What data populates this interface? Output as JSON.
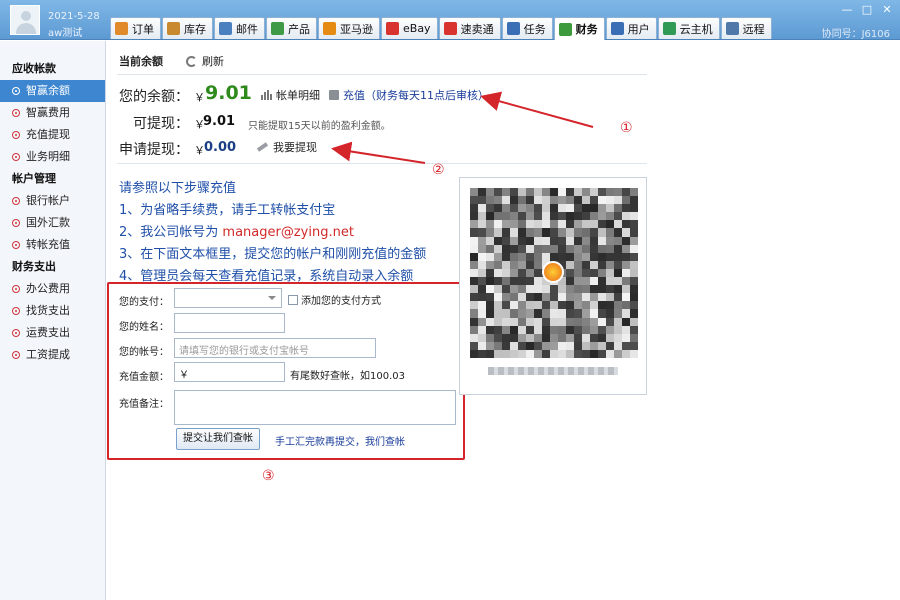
{
  "header": {
    "date": "2021-5-28",
    "user": "aw测试",
    "account_id": "协同号：J6106",
    "window_controls": [
      "—",
      "□",
      "✕"
    ],
    "tabs": [
      {
        "label": "订单",
        "icon": "order-icon",
        "color": "#e08a2c"
      },
      {
        "label": "库存",
        "icon": "inventory-icon",
        "color": "#c9892f"
      },
      {
        "label": "邮件",
        "icon": "mail-icon",
        "color": "#4a7fc0"
      },
      {
        "label": "产品",
        "icon": "product-icon",
        "color": "#3f9a48"
      },
      {
        "label": "亚马逊",
        "icon": "amazon-icon",
        "color": "#e58b14"
      },
      {
        "label": "eBay",
        "icon": "ebay-icon",
        "color": "#d8332f"
      },
      {
        "label": "速卖通",
        "icon": "aliexpress-icon",
        "color": "#d8332f"
      },
      {
        "label": "任务",
        "icon": "task-icon",
        "color": "#3a6fb5"
      },
      {
        "label": "财务",
        "icon": "finance-icon",
        "color": "#3d9b3d",
        "active": true
      },
      {
        "label": "用户",
        "icon": "user-icon",
        "color": "#3a6fb5"
      },
      {
        "label": "云主机",
        "icon": "cloud-host-icon",
        "color": "#2f9a55"
      },
      {
        "label": "远程",
        "icon": "remote-icon",
        "color": "#5078a8"
      }
    ]
  },
  "sidebar": {
    "sections": [
      {
        "title": "应收帐款",
        "items": [
          {
            "label": "智赢余额",
            "active": true
          },
          {
            "label": "智赢费用"
          },
          {
            "label": "充值提现"
          },
          {
            "label": "业务明细"
          }
        ]
      },
      {
        "title": "帐户管理",
        "items": [
          {
            "label": "银行帐户"
          },
          {
            "label": "国外汇款"
          },
          {
            "label": "转帐充值"
          }
        ]
      },
      {
        "title": "财务支出",
        "items": [
          {
            "label": "办公费用"
          },
          {
            "label": "找货支出"
          },
          {
            "label": "运费支出"
          },
          {
            "label": "工资提成"
          }
        ]
      }
    ]
  },
  "main": {
    "section_title": "当前余额",
    "refresh_label": "刷新",
    "balance_label": "您的余额：",
    "currency": "￥",
    "balance_value": "9.01",
    "statement_link": "帐单明细",
    "recharge_link": "充值（财务每天11点后审核）",
    "withdrawable_label": "可提现：",
    "withdrawable_value": "9.01",
    "withdrawable_note": "只能提取15天以前的盈利金额。",
    "request_label": "申请提现：",
    "request_value": "0.00",
    "withdraw_link": "我要提现",
    "steps": {
      "title": "请参照以下步骤充值",
      "s1": "1、为省略手续费，请手工转帐支付宝",
      "s2_prefix": "2、我公司帐号为 ",
      "s2_email": "manager@zying.net",
      "s3": "3、在下面文本框里，提交您的帐户和刚刚充值的金额",
      "s4": "4、管理员会每天查看充值记录，系统自动录入余额"
    },
    "form": {
      "payment_label": "您的支付：",
      "payment_selected": "",
      "add_payment_label": "添加您的支付方式",
      "name_label": "您的姓名：",
      "name_value": "",
      "account_label": "您的帐号：",
      "account_placeholder": "请填写您的银行或支付宝帐号",
      "amount_label": "充值金额：",
      "amount_value": "￥",
      "amount_hint": "有尾数好查帐，如100.03",
      "remark_label": "充值备注：",
      "remark_value": "",
      "submit_label": "提交让我们查帐",
      "submit_hint": "手工汇完款再提交，我们查帐"
    },
    "annotations": {
      "one": "①",
      "two": "②",
      "three": "③",
      "color": "#d4252b"
    }
  }
}
